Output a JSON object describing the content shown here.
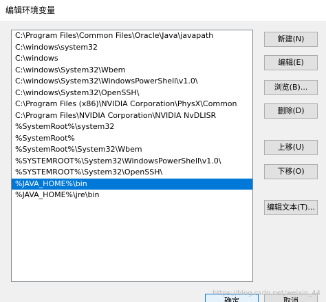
{
  "window": {
    "title": "编辑环境变量"
  },
  "paths": [
    "C:\\Program Files\\Common Files\\Oracle\\Java\\javapath",
    "C:\\windows\\system32",
    "C:\\windows",
    "C:\\windows\\System32\\Wbem",
    "C:\\windows\\System32\\WindowsPowerShell\\v1.0\\",
    "C:\\windows\\System32\\OpenSSH\\",
    "C:\\Program Files (x86)\\NVIDIA Corporation\\PhysX\\Common",
    "C:\\Program Files\\NVIDIA Corporation\\NVIDIA NvDLISR",
    "%SystemRoot%\\system32",
    "%SystemRoot%",
    "%SystemRoot%\\System32\\Wbem",
    "%SYSTEMROOT%\\System32\\WindowsPowerShell\\v1.0\\",
    "%SYSTEMROOT%\\System32\\OpenSSH\\",
    "%JAVA_HOME%\\bin",
    "%JAVA_HOME%\\jre\\bin"
  ],
  "selected_index": 13,
  "buttons": {
    "new": "新建(N)",
    "edit": "编辑(E)",
    "browse": "浏览(B)...",
    "delete": "删除(D)",
    "move_up": "上移(U)",
    "move_down": "下移(O)",
    "edit_text": "编辑文本(T)..."
  },
  "footer": {
    "ok": "确定",
    "cancel": "取消"
  },
  "watermark": "https://blog.csdn.net/weixin_44"
}
